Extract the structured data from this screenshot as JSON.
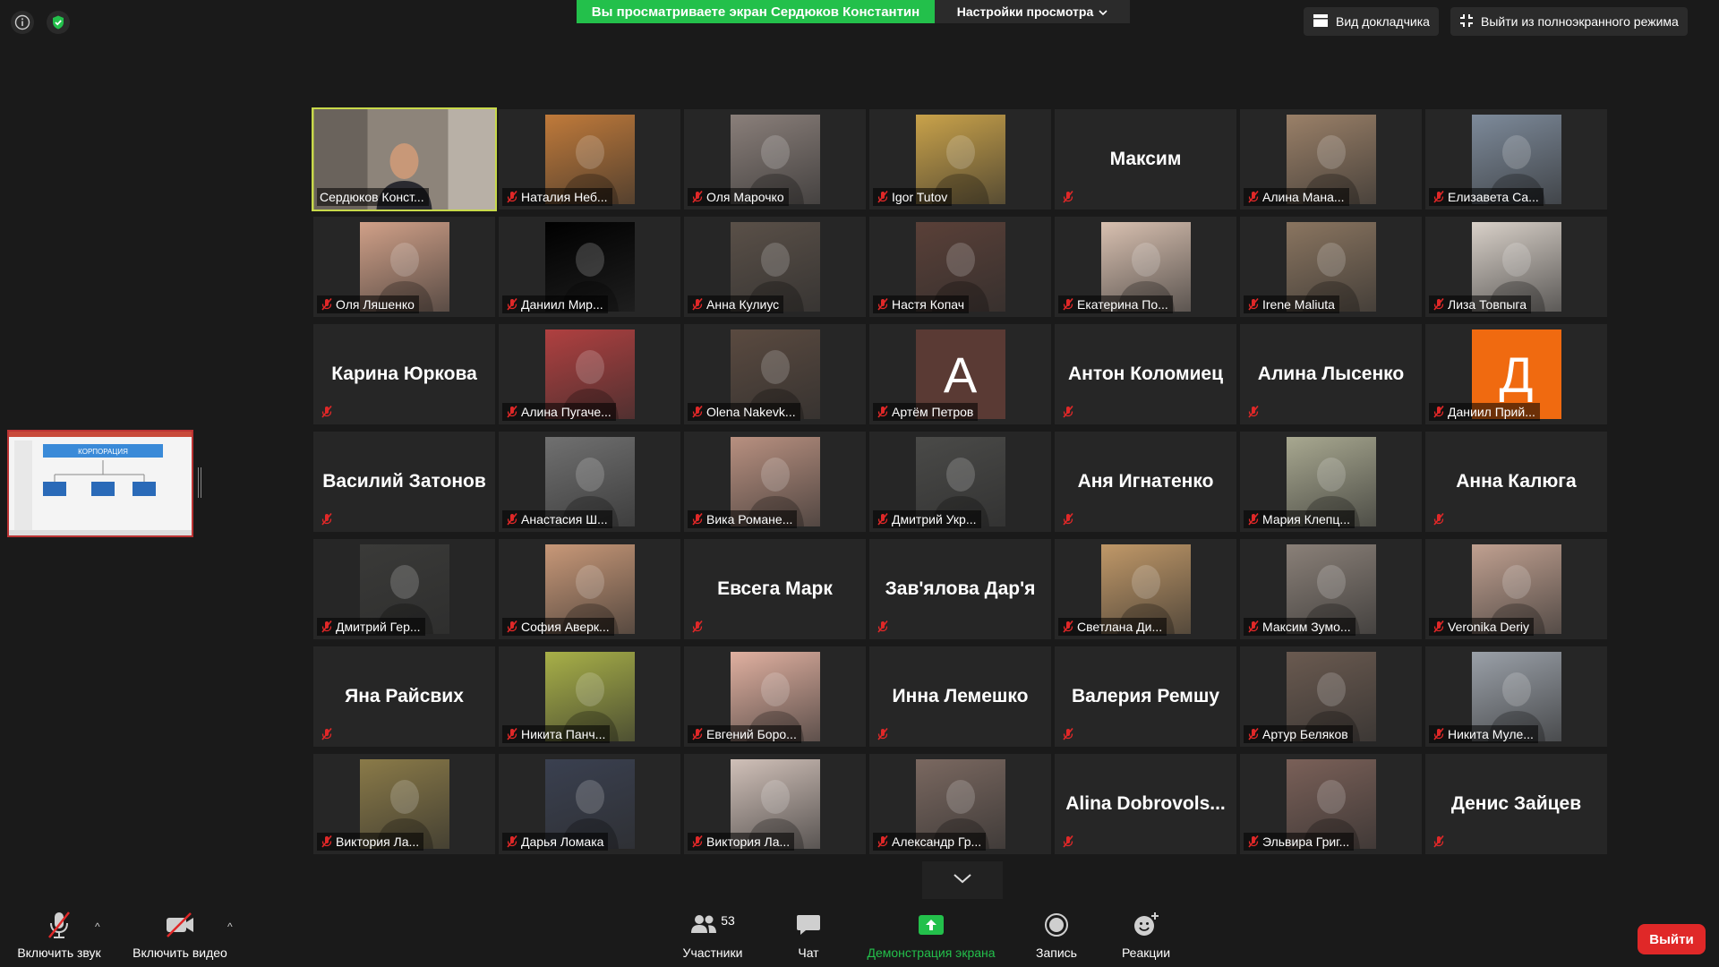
{
  "banner": {
    "viewing_text": "Вы просматриваете экран Сердюков Константин",
    "view_settings": "Настройки просмотра"
  },
  "top_right": {
    "speaker_view": "Вид докладчика",
    "exit_fullscreen": "Выйти из полноэкранного режима"
  },
  "share_thumb": {
    "slide_title": "КОРПОРАЦИЯ"
  },
  "participants": [
    {
      "name": "Сердюков Конст...",
      "kind": "video",
      "active": true,
      "muted": false,
      "color": "#9a8a7a"
    },
    {
      "name": "Наталия Неб...",
      "kind": "photo",
      "muted": true,
      "color": "#c07a3a"
    },
    {
      "name": "Оля Марочко",
      "kind": "photo",
      "muted": true,
      "color": "#8a7f7a"
    },
    {
      "name": "Igor Tutov",
      "kind": "photo",
      "muted": true,
      "color": "#c9a24a"
    },
    {
      "name": "Максим",
      "kind": "text",
      "muted": true
    },
    {
      "name": "Алина Мана...",
      "kind": "photo",
      "muted": true,
      "color": "#9a8068"
    },
    {
      "name": "Елизавета Са...",
      "kind": "photo",
      "muted": true,
      "color": "#7d8a9a"
    },
    {
      "name": "Оля Ляшенко",
      "kind": "photo",
      "muted": true,
      "color": "#d0a088"
    },
    {
      "name": "Даниил Мир...",
      "kind": "photo",
      "muted": true,
      "color": "#000000"
    },
    {
      "name": "Анна Кулиус",
      "kind": "photo",
      "muted": true,
      "color": "#5a5048"
    },
    {
      "name": "Настя Копач",
      "kind": "photo",
      "muted": true,
      "color": "#5a4038"
    },
    {
      "name": "Екатерина По...",
      "kind": "photo",
      "muted": true,
      "color": "#d8c0b0"
    },
    {
      "name": "Irene Maliuta",
      "kind": "photo",
      "muted": true,
      "color": "#8a7560"
    },
    {
      "name": "Лиза Товпыга",
      "kind": "photo",
      "muted": true,
      "color": "#d8d0c8"
    },
    {
      "name": "Карина Юркова",
      "kind": "text",
      "muted": true
    },
    {
      "name": "Алина Пугаче...",
      "kind": "photo",
      "muted": true,
      "color": "#b04040"
    },
    {
      "name": "Olena Nakevk...",
      "kind": "photo",
      "muted": true,
      "color": "#5a4a40"
    },
    {
      "name": "Артём Петров",
      "kind": "letter",
      "letter": "A",
      "muted": true,
      "color": "#5a3a34"
    },
    {
      "name": "Антон Коломиец",
      "kind": "text",
      "muted": true
    },
    {
      "name": "Алина Лысенко",
      "kind": "text",
      "muted": true
    },
    {
      "name": "Даниил Прий...",
      "kind": "letter",
      "letter": "Д",
      "muted": true,
      "color": "#f06a10"
    },
    {
      "name": "Василий Затонов",
      "kind": "text",
      "muted": true
    },
    {
      "name": "Анастасия Ш...",
      "kind": "photo",
      "muted": true,
      "color": "#707070"
    },
    {
      "name": "Вика Романе...",
      "kind": "photo",
      "muted": true,
      "color": "#b89080"
    },
    {
      "name": "Дмитрий Укр...",
      "kind": "photo",
      "muted": true,
      "color": "#4a4a48"
    },
    {
      "name": "Аня Игнатенко",
      "kind": "text",
      "muted": true
    },
    {
      "name": "Мария Клепц...",
      "kind": "photo",
      "muted": true,
      "color": "#a8a890"
    },
    {
      "name": "Анна Калюга",
      "kind": "text",
      "muted": true
    },
    {
      "name": "Дмитрий Гер...",
      "kind": "photo",
      "muted": true,
      "color": "#3a3a38"
    },
    {
      "name": "София Аверк...",
      "kind": "photo",
      "muted": true,
      "color": "#c89878"
    },
    {
      "name": "Евсега Марк",
      "kind": "text",
      "muted": true
    },
    {
      "name": "Зав'ялова Дар'я",
      "kind": "text",
      "muted": true
    },
    {
      "name": "Светлана Ди...",
      "kind": "photo",
      "muted": true,
      "color": "#c09868"
    },
    {
      "name": "Максим Зумо...",
      "kind": "photo",
      "muted": true,
      "color": "#8a8078"
    },
    {
      "name": "Veronika Deriy",
      "kind": "photo",
      "muted": true,
      "color": "#c0a090"
    },
    {
      "name": "Яна Райсвих",
      "kind": "text",
      "muted": true
    },
    {
      "name": "Никита Панч...",
      "kind": "photo",
      "muted": true,
      "color": "#a8b048"
    },
    {
      "name": "Евгений Боро...",
      "kind": "photo",
      "muted": true,
      "color": "#e0b0a0"
    },
    {
      "name": "Инна Лемешко",
      "kind": "text",
      "muted": true
    },
    {
      "name": "Валерия Ремшу",
      "kind": "text",
      "muted": true
    },
    {
      "name": "Артур Беляков",
      "kind": "photo",
      "muted": true,
      "color": "#6a5a50"
    },
    {
      "name": "Никита Муле...",
      "kind": "photo",
      "muted": true,
      "color": "#9aa0a8"
    },
    {
      "name": "Виктория Ла...",
      "kind": "photo",
      "muted": true,
      "color": "#8a7a48"
    },
    {
      "name": "Дарья Ломака",
      "kind": "photo",
      "muted": true,
      "color": "#3a4050"
    },
    {
      "name": "Виктория Ла...",
      "kind": "photo",
      "muted": true,
      "color": "#d0c0b8"
    },
    {
      "name": "Александр Гр...",
      "kind": "photo",
      "muted": true,
      "color": "#7a6860"
    },
    {
      "name": "Alina  Dobrovols...",
      "kind": "text",
      "muted": true
    },
    {
      "name": "Эльвира Григ...",
      "kind": "photo",
      "muted": true,
      "color": "#7a6058"
    },
    {
      "name": "Денис Зайцев",
      "kind": "text",
      "muted": true
    }
  ],
  "toolbar": {
    "unmute": "Включить звук",
    "start_video": "Включить видео",
    "participants": "Участники",
    "participants_count": "53",
    "chat": "Чат",
    "share_screen": "Демонстрация экрана",
    "record": "Запись",
    "reactions": "Реакции",
    "leave": "Выйти"
  },
  "colors": {
    "accent_green": "#23c04b",
    "active_speaker_border": "#c8d94a",
    "muted_red": "#e02828",
    "leave_red": "#e02828"
  }
}
